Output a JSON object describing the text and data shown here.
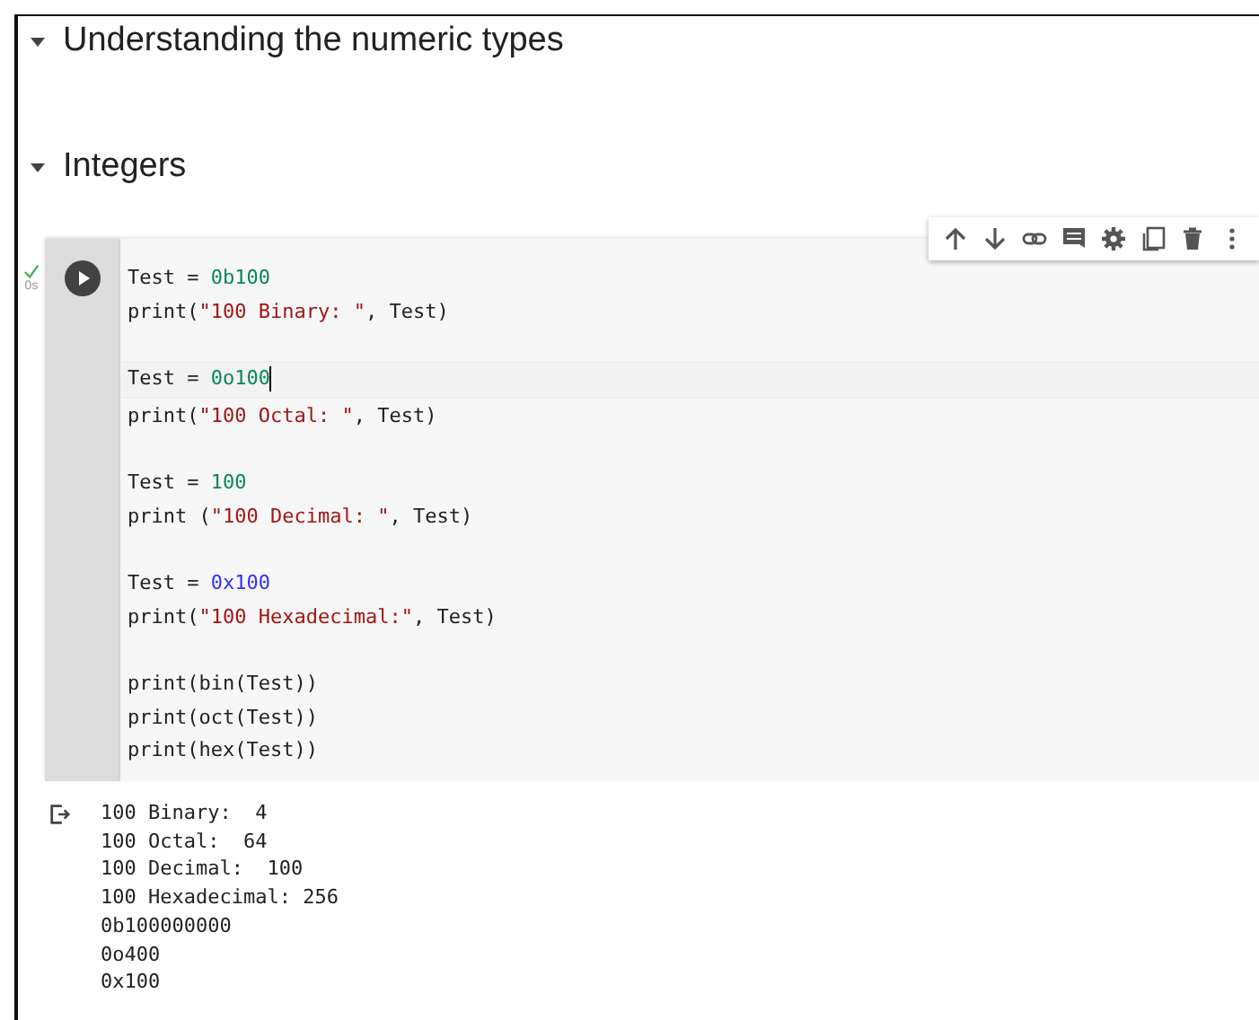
{
  "sections": [
    {
      "title": "Understanding the numeric types",
      "expanded": true
    },
    {
      "title": "Integers",
      "expanded": true
    }
  ],
  "cell": {
    "succeeded": true,
    "exec_time": "0s",
    "toolbar": [
      {
        "kind": "up"
      },
      {
        "kind": "down"
      },
      {
        "kind": "link"
      },
      {
        "kind": "comment"
      },
      {
        "kind": "settings"
      },
      {
        "kind": "copy"
      },
      {
        "kind": "delete"
      },
      {
        "kind": "more"
      }
    ],
    "blocks": [
      [
        {
          "selected": false,
          "tokens": [
            {
              "text": "Test = ",
              "kind": "plain"
            },
            {
              "text": "0b100",
              "kind": "number"
            }
          ]
        },
        {
          "selected": false,
          "tokens": [
            {
              "text": "print(",
              "kind": "plain"
            },
            {
              "text": "\"100 Binary: \"",
              "kind": "string"
            },
            {
              "text": ", Test)",
              "kind": "plain"
            }
          ]
        }
      ],
      [
        {
          "selected": true,
          "tokens": [
            {
              "text": "Test = ",
              "kind": "plain"
            },
            {
              "text": "0o100",
              "kind": "number"
            }
          ]
        },
        {
          "selected": false,
          "tokens": [
            {
              "text": "print(",
              "kind": "plain"
            },
            {
              "text": "\"100 Octal: \"",
              "kind": "string"
            },
            {
              "text": ", Test)",
              "kind": "plain"
            }
          ]
        }
      ],
      [
        {
          "selected": false,
          "tokens": [
            {
              "text": "Test = ",
              "kind": "plain"
            },
            {
              "text": "100",
              "kind": "number"
            }
          ]
        },
        {
          "selected": false,
          "tokens": [
            {
              "text": "print (",
              "kind": "plain"
            },
            {
              "text": "\"100 Decimal: \"",
              "kind": "string"
            },
            {
              "text": ", Test)",
              "kind": "plain"
            }
          ]
        }
      ],
      [
        {
          "selected": false,
          "tokens": [
            {
              "text": "Test = ",
              "kind": "plain"
            },
            {
              "text": "0x100",
              "kind": "hex"
            }
          ]
        },
        {
          "selected": false,
          "tokens": [
            {
              "text": "print(",
              "kind": "plain"
            },
            {
              "text": "\"100 Hexadecimal:\"",
              "kind": "string"
            },
            {
              "text": ", Test)",
              "kind": "plain"
            }
          ]
        }
      ],
      [
        {
          "selected": false,
          "tokens": [
            {
              "text": "print(bin(Test))",
              "kind": "plain"
            }
          ]
        },
        {
          "selected": false,
          "tokens": [
            {
              "text": "print(oct(Test))",
              "kind": "plain"
            }
          ]
        },
        {
          "selected": false,
          "tokens": [
            {
              "text": "print(hex(Test))",
              "kind": "plain"
            }
          ]
        }
      ]
    ],
    "output": [
      "100 Binary:  4",
      "100 Octal:  64",
      "100 Decimal:  100",
      "100 Hexadecimal: 256",
      "0b100000000",
      "0o400",
      "0x100"
    ]
  }
}
